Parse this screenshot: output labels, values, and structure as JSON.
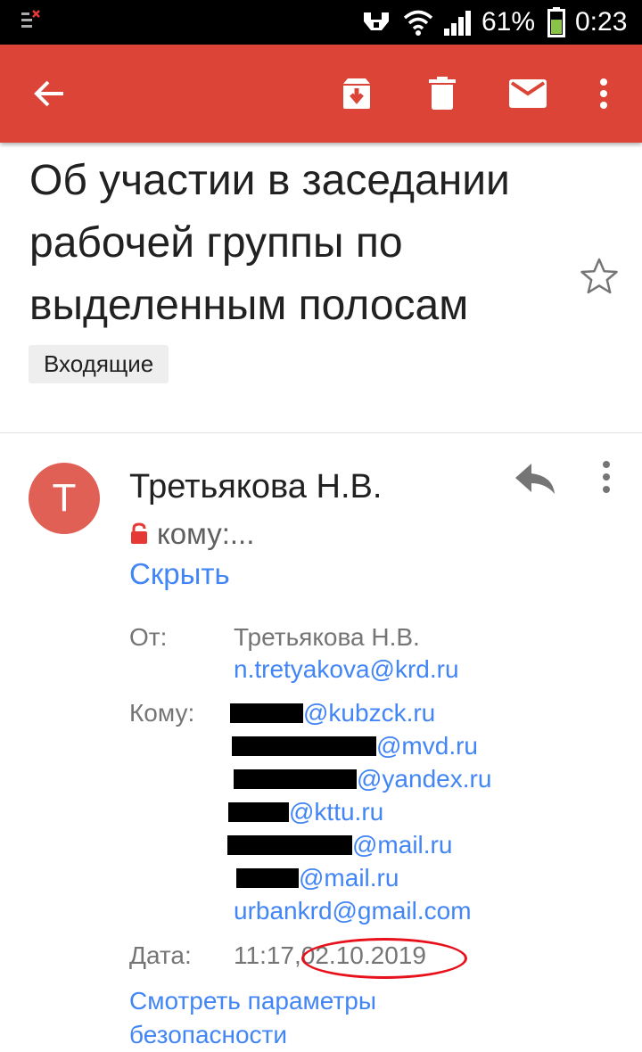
{
  "status_bar": {
    "battery": "61%",
    "time": "0:23",
    "icons": [
      "notification-icon",
      "headset-icon",
      "wifi-icon",
      "signal-icon",
      "battery-icon"
    ]
  },
  "app_bar": {
    "color": "#db4437",
    "icons": [
      "back-arrow-icon",
      "archive-icon",
      "delete-icon",
      "mark-unread-icon",
      "more-vert-icon"
    ]
  },
  "email": {
    "subject": "Об участии в заседании рабочей группы по выделенным полосам",
    "label": "Входящие",
    "sender": {
      "avatar_letter": "T",
      "avatar_color": "#e06055",
      "name": "Третьякова Н.В.",
      "to_short": "кому:...",
      "hide_link": "Скрыть"
    },
    "details": {
      "from_label": "От:",
      "from_name": "Третьякова Н.В.",
      "from_email": "n.tretyakova@krd.ru",
      "to_label": "Кому:",
      "recipients": [
        {
          "visible": "@kubzck.ru",
          "redacted": true
        },
        {
          "visible": "@mvd.ru",
          "redacted": true
        },
        {
          "visible": "@yandex.ru",
          "redacted": true
        },
        {
          "visible": "@kttu.ru",
          "redacted": true
        },
        {
          "visible": "@mail.ru",
          "redacted": true
        },
        {
          "visible": "@mail.ru",
          "redacted": true
        },
        {
          "visible": "urbankrd@gmail.com",
          "redacted": false
        }
      ],
      "date_label": "Дата:",
      "time": "11:17,",
      "date": "02.10.2019",
      "security_link": "Смотреть параметры безопасности"
    }
  },
  "colors": {
    "link": "#4285f4",
    "highlight_circle": "#e8101a"
  }
}
